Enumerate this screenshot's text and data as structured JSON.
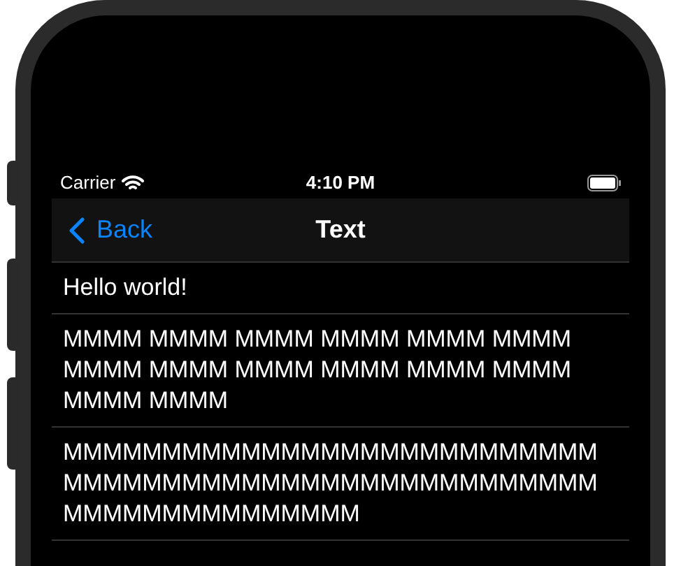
{
  "status_bar": {
    "carrier": "Carrier",
    "time": "4:10 PM"
  },
  "nav_bar": {
    "back": "Back",
    "title": "Text"
  },
  "rows": [
    {
      "text": "Hello world!"
    },
    {
      "text": "MMMM MMMM MMMM MMMM MMMM MMMM MMMM MMMM MMMM MMMM MMMM MMMM MMMM MMMM"
    },
    {
      "text": "MMMMMMMMMMMMMMMMMMMMMMMMMMMMMMMMMMMMMMMMMMMMMMMMMMMMMMMMMMMMMMMMMMMMM"
    }
  ]
}
